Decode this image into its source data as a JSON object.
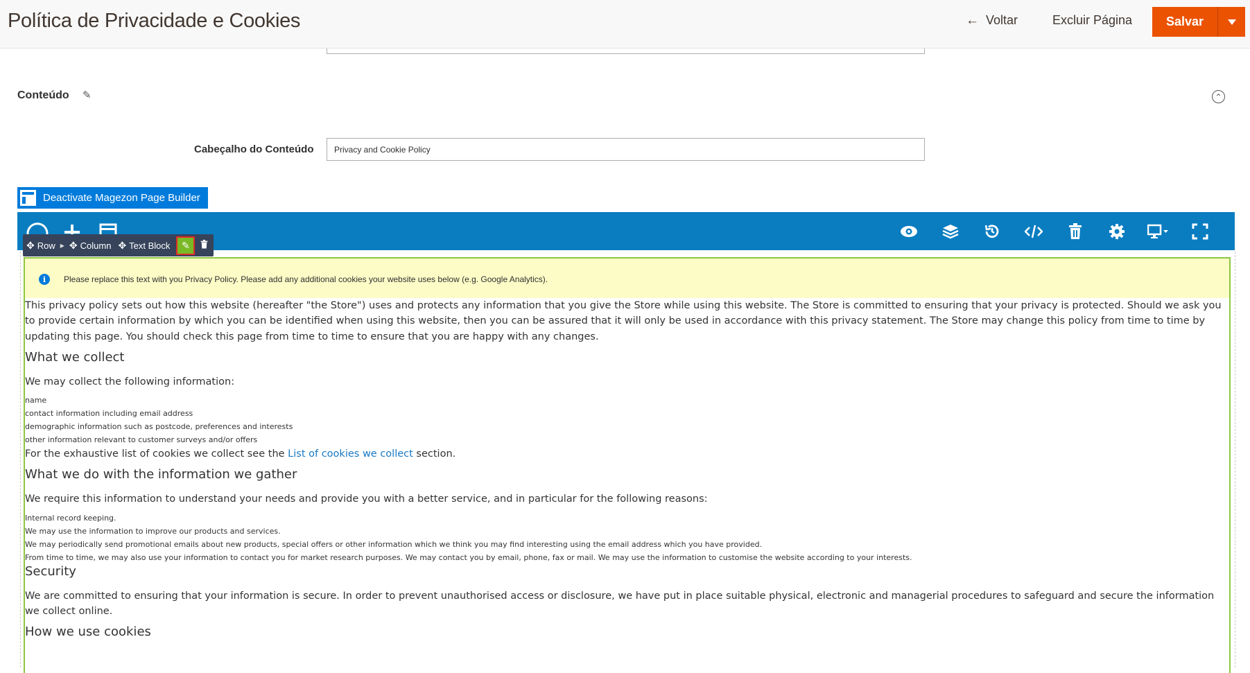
{
  "header": {
    "title": "Política de Privacidade e Cookies",
    "back_label": "Voltar",
    "delete_label": "Excluir Página",
    "save_label": "Salvar"
  },
  "content_section": {
    "title": "Conteúdo",
    "field_label": "Cabeçalho do Conteúdo",
    "field_value": "Privacy and Cookie Policy"
  },
  "builder": {
    "deactivate_label": "Deactivate Magezon Page Builder",
    "toolbar_icons": [
      "loading-icon",
      "add-icon",
      "templates-icon",
      "preview-icon",
      "layers-icon",
      "history-icon",
      "code-icon",
      "trash-icon",
      "settings-icon",
      "desktop-icon",
      "fullscreen-icon"
    ],
    "element_bar": {
      "row": "Row",
      "column": "Column",
      "text_block": "Text Block"
    }
  },
  "document": {
    "notice": "Please replace this text with you Privacy Policy. Please add any additional cookies your website uses below (e.g. Google Analytics).",
    "intro": "This privacy policy sets out how this website (hereafter \"the Store\") uses and protects any information that you give the Store while using this website. The Store is committed to ensuring that your privacy is protected. Should we ask you to provide certain information by which you can be identified when using this website, then you can be assured that it will only be used in accordance with this privacy statement. The Store may change this policy from time to time by updating this page. You should check this page from time to time to ensure that you are happy with any changes.",
    "h_collect": "What we collect",
    "collect_intro": "We may collect the following information:",
    "collect_items": [
      "name",
      "contact information including email address",
      "demographic information such as postcode, preferences and interests",
      "other information relevant to customer surveys and/or offers"
    ],
    "cookies_pre": "For the exhaustive list of cookies we collect see the ",
    "cookies_link": "List of cookies we collect",
    "cookies_post": " section.",
    "h_gather": "What we do with the information we gather",
    "gather_intro": "We require this information to understand your needs and provide you with a better service, and in particular for the following reasons:",
    "gather_items": [
      "Internal record keeping.",
      "We may use the information to improve our products and services.",
      "We may periodically send promotional emails about new products, special offers or other information which we think you may find interesting using the email address which you have provided.",
      "From time to time, we may also use your information to contact you for market research purposes. We may contact you by email, phone, fax or mail. We may use the information to customise the website according to your interests."
    ],
    "h_security": "Security",
    "security_text": "We are committed to ensuring that your information is secure. In order to prevent unauthorised access or disclosure, we have put in place suitable physical, electronic and managerial procedures to safeguard and secure the information we collect online.",
    "h_cookies": "How we use cookies"
  }
}
